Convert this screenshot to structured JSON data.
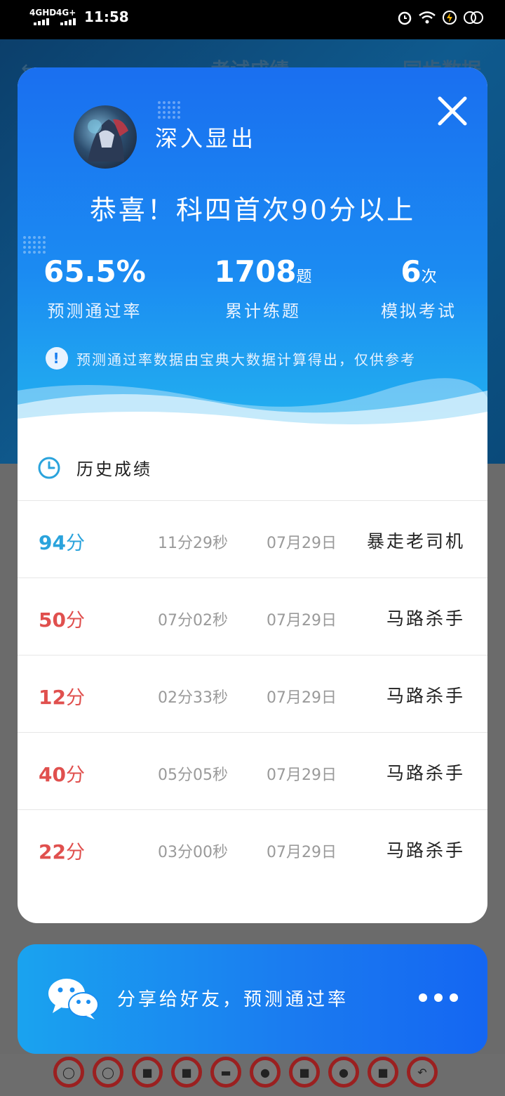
{
  "status_bar": {
    "network1": "4GHD",
    "network2": "4G+",
    "time": "11:58"
  },
  "background": {
    "title": "考试成绩",
    "sync": "同步数据",
    "back_icon": "arrow-left-icon"
  },
  "modal": {
    "username": "深入显出",
    "headline": "恭喜！科四首次90分以上",
    "stats": [
      {
        "value": "65.5%",
        "unit": "",
        "label": "预测通过率"
      },
      {
        "value": "1708",
        "unit": "题",
        "label": "累计练题"
      },
      {
        "value": "6",
        "unit": "次",
        "label": "模拟考试"
      }
    ],
    "note": "预测通过率数据由宝典大数据计算得出，仅供参考",
    "history_title": "历史成绩",
    "score_unit": "分",
    "records": [
      {
        "score": "94",
        "duration": "11分29秒",
        "date": "07月29日",
        "title": "暴走老司机",
        "color": "#2aa3dc"
      },
      {
        "score": "50",
        "duration": "07分02秒",
        "date": "07月29日",
        "title": "马路杀手",
        "color": "#e0504e"
      },
      {
        "score": "12",
        "duration": "02分33秒",
        "date": "07月29日",
        "title": "马路杀手",
        "color": "#e0504e"
      },
      {
        "score": "40",
        "duration": "05分05秒",
        "date": "07月29日",
        "title": "马路杀手",
        "color": "#e0504e"
      },
      {
        "score": "22",
        "duration": "03分00秒",
        "date": "07月29日",
        "title": "马路杀手",
        "color": "#e0504e"
      }
    ]
  },
  "share": {
    "label": "分享给好友，预测通过率",
    "icon": "wechat-icon"
  },
  "colors": {
    "accent_blue": "#1a7af0",
    "pass_score": "#2aa3dc",
    "fail_score": "#e0504e"
  }
}
